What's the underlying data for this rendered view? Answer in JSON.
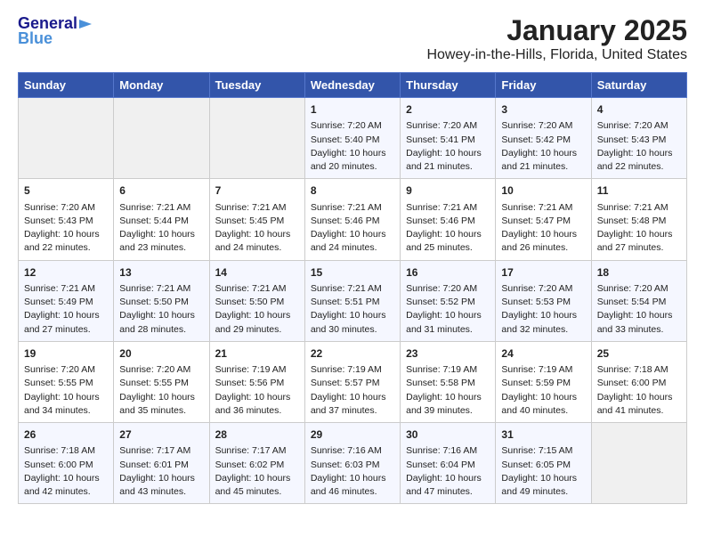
{
  "logo": {
    "general": "General",
    "blue": "Blue"
  },
  "title": "January 2025",
  "subtitle": "Howey-in-the-Hills, Florida, United States",
  "days_of_week": [
    "Sunday",
    "Monday",
    "Tuesday",
    "Wednesday",
    "Thursday",
    "Friday",
    "Saturday"
  ],
  "weeks": [
    [
      {
        "num": "",
        "content": "",
        "empty": true
      },
      {
        "num": "",
        "content": "",
        "empty": true
      },
      {
        "num": "",
        "content": "",
        "empty": true
      },
      {
        "num": "1",
        "content": "Sunrise: 7:20 AM\nSunset: 5:40 PM\nDaylight: 10 hours\nand 20 minutes.",
        "empty": false
      },
      {
        "num": "2",
        "content": "Sunrise: 7:20 AM\nSunset: 5:41 PM\nDaylight: 10 hours\nand 21 minutes.",
        "empty": false
      },
      {
        "num": "3",
        "content": "Sunrise: 7:20 AM\nSunset: 5:42 PM\nDaylight: 10 hours\nand 21 minutes.",
        "empty": false
      },
      {
        "num": "4",
        "content": "Sunrise: 7:20 AM\nSunset: 5:43 PM\nDaylight: 10 hours\nand 22 minutes.",
        "empty": false
      }
    ],
    [
      {
        "num": "5",
        "content": "Sunrise: 7:20 AM\nSunset: 5:43 PM\nDaylight: 10 hours\nand 22 minutes.",
        "empty": false
      },
      {
        "num": "6",
        "content": "Sunrise: 7:21 AM\nSunset: 5:44 PM\nDaylight: 10 hours\nand 23 minutes.",
        "empty": false
      },
      {
        "num": "7",
        "content": "Sunrise: 7:21 AM\nSunset: 5:45 PM\nDaylight: 10 hours\nand 24 minutes.",
        "empty": false
      },
      {
        "num": "8",
        "content": "Sunrise: 7:21 AM\nSunset: 5:46 PM\nDaylight: 10 hours\nand 24 minutes.",
        "empty": false
      },
      {
        "num": "9",
        "content": "Sunrise: 7:21 AM\nSunset: 5:46 PM\nDaylight: 10 hours\nand 25 minutes.",
        "empty": false
      },
      {
        "num": "10",
        "content": "Sunrise: 7:21 AM\nSunset: 5:47 PM\nDaylight: 10 hours\nand 26 minutes.",
        "empty": false
      },
      {
        "num": "11",
        "content": "Sunrise: 7:21 AM\nSunset: 5:48 PM\nDaylight: 10 hours\nand 27 minutes.",
        "empty": false
      }
    ],
    [
      {
        "num": "12",
        "content": "Sunrise: 7:21 AM\nSunset: 5:49 PM\nDaylight: 10 hours\nand 27 minutes.",
        "empty": false
      },
      {
        "num": "13",
        "content": "Sunrise: 7:21 AM\nSunset: 5:50 PM\nDaylight: 10 hours\nand 28 minutes.",
        "empty": false
      },
      {
        "num": "14",
        "content": "Sunrise: 7:21 AM\nSunset: 5:50 PM\nDaylight: 10 hours\nand 29 minutes.",
        "empty": false
      },
      {
        "num": "15",
        "content": "Sunrise: 7:21 AM\nSunset: 5:51 PM\nDaylight: 10 hours\nand 30 minutes.",
        "empty": false
      },
      {
        "num": "16",
        "content": "Sunrise: 7:20 AM\nSunset: 5:52 PM\nDaylight: 10 hours\nand 31 minutes.",
        "empty": false
      },
      {
        "num": "17",
        "content": "Sunrise: 7:20 AM\nSunset: 5:53 PM\nDaylight: 10 hours\nand 32 minutes.",
        "empty": false
      },
      {
        "num": "18",
        "content": "Sunrise: 7:20 AM\nSunset: 5:54 PM\nDaylight: 10 hours\nand 33 minutes.",
        "empty": false
      }
    ],
    [
      {
        "num": "19",
        "content": "Sunrise: 7:20 AM\nSunset: 5:55 PM\nDaylight: 10 hours\nand 34 minutes.",
        "empty": false
      },
      {
        "num": "20",
        "content": "Sunrise: 7:20 AM\nSunset: 5:55 PM\nDaylight: 10 hours\nand 35 minutes.",
        "empty": false
      },
      {
        "num": "21",
        "content": "Sunrise: 7:19 AM\nSunset: 5:56 PM\nDaylight: 10 hours\nand 36 minutes.",
        "empty": false
      },
      {
        "num": "22",
        "content": "Sunrise: 7:19 AM\nSunset: 5:57 PM\nDaylight: 10 hours\nand 37 minutes.",
        "empty": false
      },
      {
        "num": "23",
        "content": "Sunrise: 7:19 AM\nSunset: 5:58 PM\nDaylight: 10 hours\nand 39 minutes.",
        "empty": false
      },
      {
        "num": "24",
        "content": "Sunrise: 7:19 AM\nSunset: 5:59 PM\nDaylight: 10 hours\nand 40 minutes.",
        "empty": false
      },
      {
        "num": "25",
        "content": "Sunrise: 7:18 AM\nSunset: 6:00 PM\nDaylight: 10 hours\nand 41 minutes.",
        "empty": false
      }
    ],
    [
      {
        "num": "26",
        "content": "Sunrise: 7:18 AM\nSunset: 6:00 PM\nDaylight: 10 hours\nand 42 minutes.",
        "empty": false
      },
      {
        "num": "27",
        "content": "Sunrise: 7:17 AM\nSunset: 6:01 PM\nDaylight: 10 hours\nand 43 minutes.",
        "empty": false
      },
      {
        "num": "28",
        "content": "Sunrise: 7:17 AM\nSunset: 6:02 PM\nDaylight: 10 hours\nand 45 minutes.",
        "empty": false
      },
      {
        "num": "29",
        "content": "Sunrise: 7:16 AM\nSunset: 6:03 PM\nDaylight: 10 hours\nand 46 minutes.",
        "empty": false
      },
      {
        "num": "30",
        "content": "Sunrise: 7:16 AM\nSunset: 6:04 PM\nDaylight: 10 hours\nand 47 minutes.",
        "empty": false
      },
      {
        "num": "31",
        "content": "Sunrise: 7:15 AM\nSunset: 6:05 PM\nDaylight: 10 hours\nand 49 minutes.",
        "empty": false
      },
      {
        "num": "",
        "content": "",
        "empty": true
      }
    ]
  ]
}
